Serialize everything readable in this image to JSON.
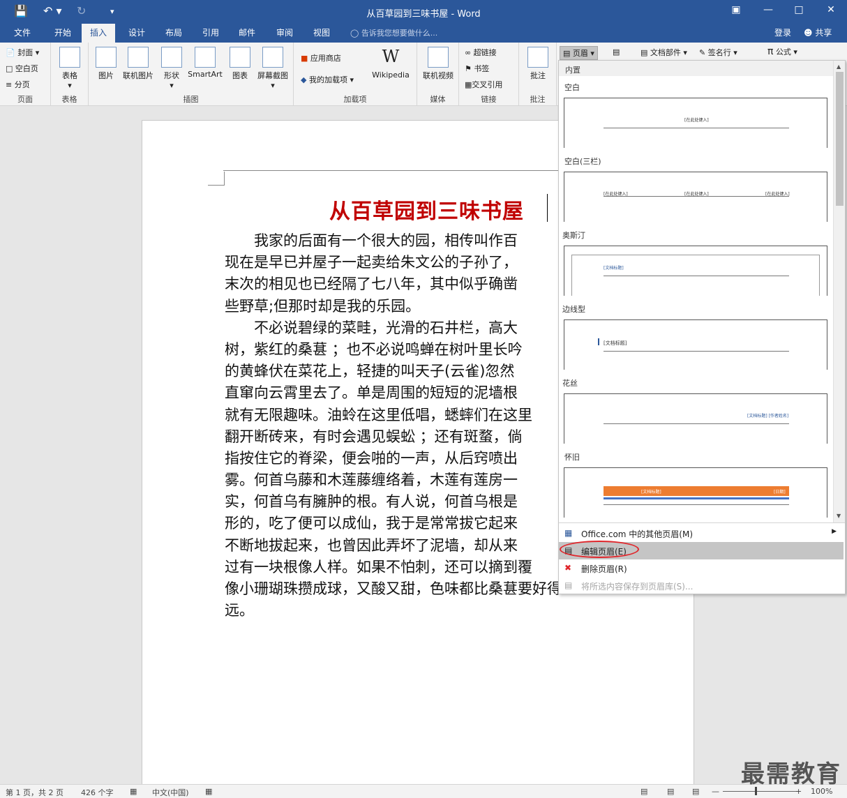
{
  "titlebar": {
    "title": "从百草园到三味书屋 - Word",
    "save_icon": "save-icon",
    "undo_icon": "undo-icon",
    "redo_icon": "redo-icon"
  },
  "tabs": [
    "文件",
    "开始",
    "插入",
    "设计",
    "布局",
    "引用",
    "邮件",
    "审阅",
    "视图"
  ],
  "active_tab": "插入",
  "tell_me": "告诉我您想要做什么...",
  "signin": "登录",
  "share": "共享",
  "ribbon": {
    "pages": {
      "cover": "封面",
      "blank": "空白页",
      "break": "分页",
      "label": "页面"
    },
    "tables": {
      "table": "表格",
      "label": "表格"
    },
    "illustrations": {
      "picture": "图片",
      "online_picture": "联机图片",
      "shapes": "形状",
      "smartart": "SmartArt",
      "chart": "图表",
      "screenshot": "屏幕截图",
      "label": "插图"
    },
    "addins": {
      "store": "应用商店",
      "my_addins": "我的加载项",
      "wikipedia": "Wikipedia",
      "label": "加载项"
    },
    "media": {
      "online_video": "联机视频",
      "label": "媒体"
    },
    "links": {
      "hyperlink": "超链接",
      "bookmark": "书签",
      "crossref": "交叉引用",
      "label": "链接"
    },
    "comments": {
      "comment": "批注",
      "label": "批注"
    },
    "header": "页眉",
    "quickparts": "文档部件",
    "signature": "签名行",
    "equation": "公式"
  },
  "document": {
    "title": "从百草园到三味书屋",
    "lines": [
      "　　我家的后面有一个很大的园，相传叫作百",
      "现在是早已并屋子一起卖给朱文公的子孙了，",
      "末次的相见也已经隔了七八年，其中似乎确凿",
      "些野草;但那时却是我的乐园。",
      "　　不必说碧绿的菜畦，光滑的石井栏，高大",
      "树，紫红的桑葚 ；也不必说鸣蝉在树叶里长吟",
      "的黄蜂伏在菜花上，轻捷的叫天子(云雀)忽然",
      "直窜向云霄里去了。单是周围的短短的泥墙根",
      "就有无限趣味。油蛉在这里低唱，蟋蟀们在这里",
      "翻开断砖来，有时会遇见蜈蚣 ；还有斑蝥，倘",
      "指按住它的脊梁，便会啪的一声，从后窍喷出",
      "雾。何首乌藤和木莲藤缠络着，木莲有莲房一",
      "实，何首乌有臃肿的根。有人说，何首乌根是",
      "形的，吃了便可以成仙，我于是常常拔它起来",
      "不断地拔起来，也曾因此弄坏了泥墙，却从来",
      "过有一块根像人样。如果不怕刺，还可以摘到覆",
      "像小珊瑚珠攒成球，又酸又甜，色味都比桑葚要好得",
      "远。"
    ]
  },
  "gallery": {
    "category": "内置",
    "items": [
      {
        "name": "空白",
        "ph": [
          "[在此处键入]"
        ]
      },
      {
        "name": "空白(三栏)",
        "ph": [
          "[在此处键入]",
          "[在此处键入]",
          "[在此处键入]"
        ]
      },
      {
        "name": "奥斯汀",
        "ph": [
          "[文档标题]"
        ]
      },
      {
        "name": "边线型",
        "ph": [
          "[文档标题]"
        ]
      },
      {
        "name": "花丝",
        "ph": [
          "[文档标题] [作者姓名]"
        ]
      },
      {
        "name": "怀旧",
        "ph": [
          "[文档标题]",
          "[日期]"
        ]
      }
    ],
    "menu": [
      {
        "label": "Office.com 中的其他页眉(M)",
        "icon": "office-icon"
      },
      {
        "label": "编辑页眉(E)",
        "icon": "edit-header-icon"
      },
      {
        "label": "删除页眉(R)",
        "icon": "delete-header-icon"
      },
      {
        "label": "将所选内容保存到页眉库(S)...",
        "icon": "save-selection-icon"
      }
    ]
  },
  "status": {
    "page": "第 1 页，共 2 页",
    "words": "426 个字",
    "lang": "中文(中国)",
    "zoom": "100%"
  },
  "watermark": "最需教育"
}
